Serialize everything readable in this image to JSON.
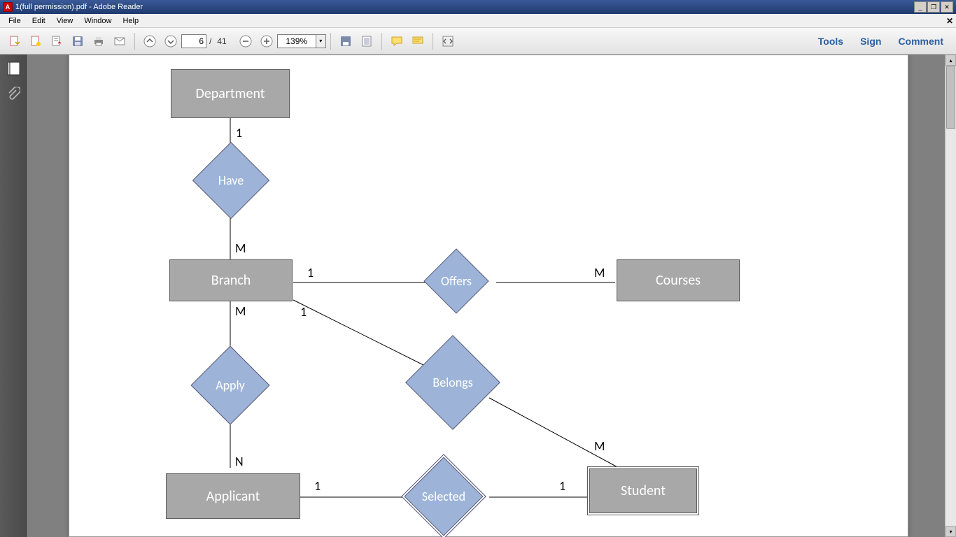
{
  "window": {
    "title": "1(full permission).pdf - Adobe Reader"
  },
  "menu": {
    "items": [
      "File",
      "Edit",
      "View",
      "Window",
      "Help"
    ]
  },
  "toolbar": {
    "page_current": "6",
    "page_total": "41",
    "page_sep": "/",
    "zoom": "139%"
  },
  "rightlinks": {
    "tools": "Tools",
    "sign": "Sign",
    "comment": "Comment"
  },
  "er": {
    "entities": {
      "department": "Department",
      "branch": "Branch",
      "courses": "Courses",
      "applicant": "Applicant",
      "student": "Student"
    },
    "relationships": {
      "have": "Have",
      "offers": "Offers",
      "apply": "Apply",
      "belongs": "Belongs",
      "selected": "Selected"
    },
    "cards": {
      "dep_have": "1",
      "have_branch": "M",
      "branch_offers": "1",
      "offers_courses": "M",
      "branch_apply": "M",
      "apply_applicant": "N",
      "branch_belongs": "1",
      "belongs_student": "M",
      "applicant_selected": "1",
      "selected_student": "1"
    }
  }
}
